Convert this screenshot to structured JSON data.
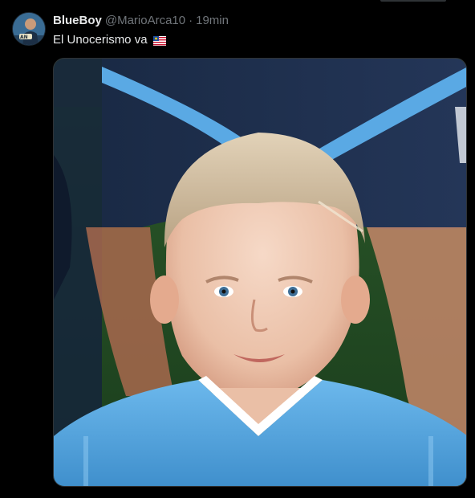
{
  "tweet": {
    "display_name": "BlueBoy",
    "handle": "@MarioArca10",
    "separator": "·",
    "timestamp": "19min",
    "text": "El Unocerismo va",
    "emoji_icon": "flag-icon",
    "avatar_icon": "avatar-icon"
  },
  "media": {
    "icon": "photo-icon"
  },
  "colors": {
    "background": "#000000",
    "primary_text": "#e7e9ea",
    "secondary_text": "#71767b",
    "border": "#2f3336"
  }
}
